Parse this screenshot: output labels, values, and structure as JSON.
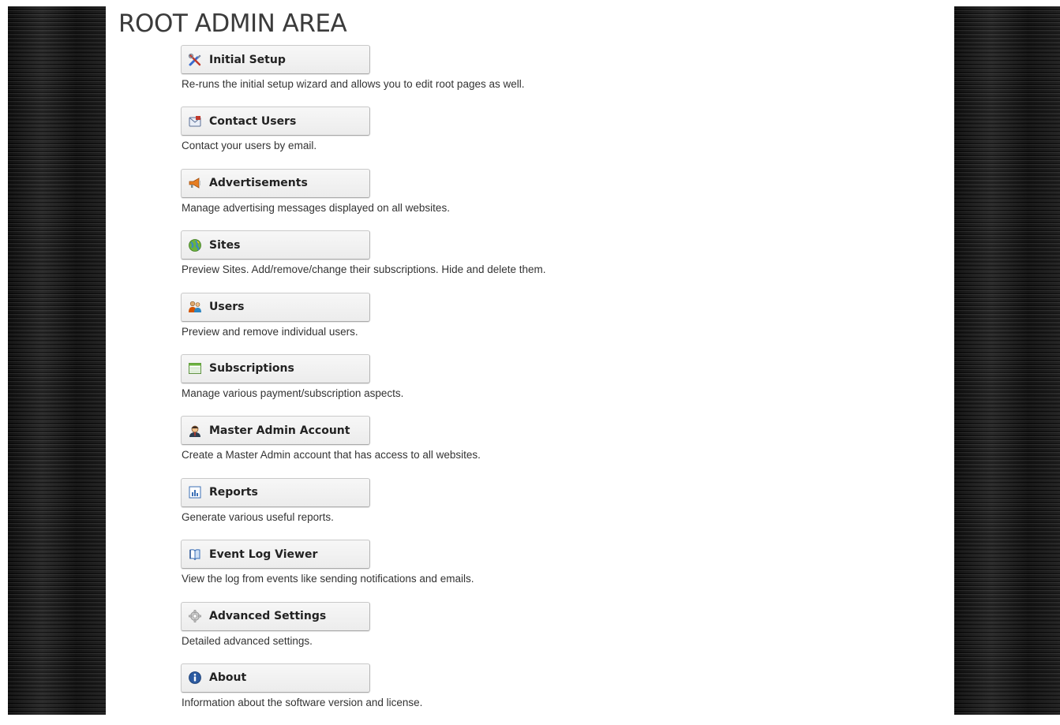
{
  "page": {
    "title": "ROOT ADMIN AREA"
  },
  "colors": {
    "background": "#ffffff",
    "side_panels": "#141414",
    "button_bg": "#f2f2f2",
    "button_border": "#c9c9c9",
    "text": "#333333"
  },
  "menu": {
    "items": [
      {
        "icon": "tools-icon",
        "label": "Initial Setup",
        "description": "Re-runs the initial setup wizard and allows you to edit root pages as well."
      },
      {
        "icon": "mail-icon",
        "label": "Contact Users",
        "description": "Contact your users by email."
      },
      {
        "icon": "megaphone-icon",
        "label": "Advertisements",
        "description": "Manage advertising messages displayed on all websites."
      },
      {
        "icon": "globe-icon",
        "label": "Sites",
        "description": "Preview Sites. Add/remove/change their subscriptions. Hide and delete them."
      },
      {
        "icon": "users-icon",
        "label": "Users",
        "description": "Preview and remove individual users."
      },
      {
        "icon": "table-icon",
        "label": "Subscriptions",
        "description": "Manage various payment/subscription aspects."
      },
      {
        "icon": "admin-icon",
        "label": "Master Admin Account",
        "description": "Create a Master Admin account that has access to all websites."
      },
      {
        "icon": "chart-icon",
        "label": "Reports",
        "description": "Generate various useful reports."
      },
      {
        "icon": "book-icon",
        "label": "Event Log Viewer",
        "description": "View the log from events like sending notifications and emails."
      },
      {
        "icon": "gear-icon",
        "label": "Advanced Settings",
        "description": "Detailed advanced settings."
      },
      {
        "icon": "info-icon",
        "label": "About",
        "description": "Information about the software version and license."
      }
    ]
  }
}
